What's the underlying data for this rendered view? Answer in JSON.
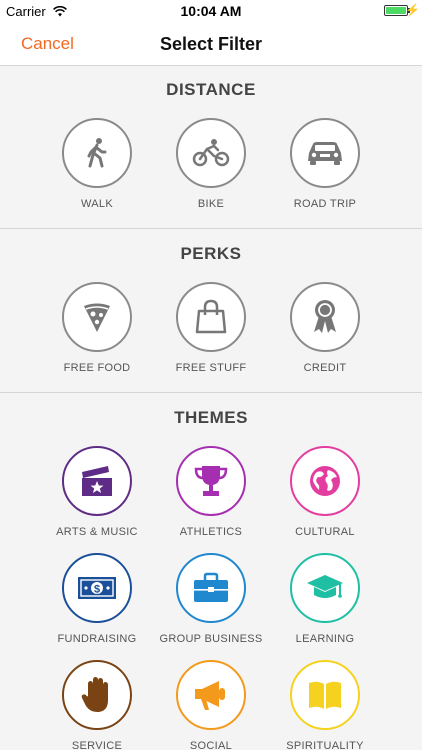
{
  "status_bar": {
    "carrier": "Carrier",
    "time": "10:04 AM"
  },
  "nav": {
    "cancel": "Cancel",
    "title": "Select Filter"
  },
  "sections": {
    "distance": {
      "header": "DISTANCE",
      "items": [
        {
          "label": "WALK",
          "icon": "walk-icon"
        },
        {
          "label": "BIKE",
          "icon": "bike-icon"
        },
        {
          "label": "ROAD TRIP",
          "icon": "car-icon"
        }
      ]
    },
    "perks": {
      "header": "PERKS",
      "items": [
        {
          "label": "FREE FOOD",
          "icon": "pizza-icon"
        },
        {
          "label": "FREE STUFF",
          "icon": "shopping-bag-icon"
        },
        {
          "label": "CREDIT",
          "icon": "award-ribbon-icon"
        }
      ]
    },
    "themes": {
      "header": "THEMES",
      "items": [
        {
          "label": "ARTS & MUSIC",
          "icon": "clapperboard-icon",
          "color": "#5e2c86"
        },
        {
          "label": "ATHLETICS",
          "icon": "trophy-icon",
          "color": "#a62fb1"
        },
        {
          "label": "CULTURAL",
          "icon": "globe-icon",
          "color": "#e43da0"
        },
        {
          "label": "FUNDRAISING",
          "icon": "money-icon",
          "color": "#1c4f99"
        },
        {
          "label": "GROUP BUSINESS",
          "icon": "briefcase-icon",
          "color": "#1f88cf"
        },
        {
          "label": "LEARNING",
          "icon": "graduation-cap-icon",
          "color": "#1fbfa4"
        },
        {
          "label": "SERVICE",
          "icon": "hand-icon",
          "color": "#7a4313"
        },
        {
          "label": "SOCIAL",
          "icon": "megaphone-icon",
          "color": "#f39a1c"
        },
        {
          "label": "SPIRITUALITY",
          "icon": "book-icon",
          "color": "#f5d21f"
        }
      ]
    }
  }
}
